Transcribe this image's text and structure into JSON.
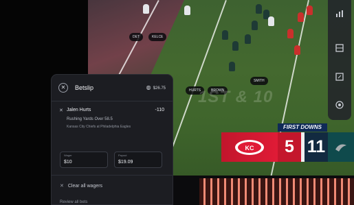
{
  "betslip": {
    "title": "Betslip",
    "balance": "$26.75",
    "close_icon": "close-icon",
    "wallet_icon": "wallet-icon",
    "bet": {
      "remove_icon": "close-icon",
      "player": "Jalen Hurts",
      "odds": "-110",
      "market": "Rushing Yards Over 58.5",
      "game": "Kansas City Chiefs at Philadelphia Eagles",
      "wager_label": "Wager",
      "wager_value": "$10",
      "payout_label": "Payout",
      "payout_value": "$19.09"
    },
    "clear_label": "Clear all wagers",
    "review_label": "Review all bets"
  },
  "broadcast": {
    "scorebug": {
      "label": "FIRST DOWNS",
      "home_score": "5",
      "away_score": "11",
      "home_color": "#e01b36",
      "away_color": "#0f4a4c"
    },
    "field_marker": "1ST & 10",
    "player_tags": [
      "DET",
      "KELCE",
      "HURTS",
      "SMITH",
      "BROWN"
    ]
  },
  "rail": {
    "icons": [
      "stats-icon",
      "grid-icon",
      "expand-icon",
      "settings-icon"
    ]
  },
  "colors": {
    "accent": "#f08a75",
    "panel": "#1c1d22"
  }
}
